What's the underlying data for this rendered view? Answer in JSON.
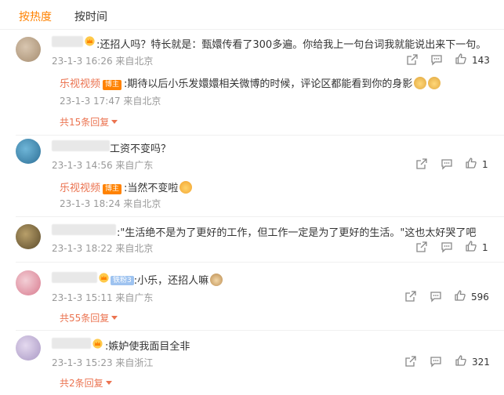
{
  "tabs": {
    "hot": "按热度",
    "time": "按时间"
  },
  "comments": [
    {
      "text": ":还招人吗？特长就是：甄嬛传看了300多遍。你给我上一句台词我就能说出来下一句。",
      "meta": "23-1-3 16:26 来自北京",
      "likes": "143",
      "reply": {
        "name": "乐视视频",
        "badge": "博主",
        "text": ":期待以后小乐发嬛嬛相关微博的时候，评论区都能看到你的身影",
        "meta": "23-1-3 17:47 来自北京"
      },
      "more": "共15条回复"
    },
    {
      "text": "工资不变吗？",
      "meta": "23-1-3 14:56 来自广东",
      "likes": "1",
      "reply": {
        "name": "乐视视频",
        "badge": "博主",
        "text": ":当然不变啦",
        "meta": "23-1-3 18:24 来自北京"
      }
    },
    {
      "text": ":\"生活绝不是为了更好的工作，但工作一定是为了更好的生活。\"这也太好哭了吧",
      "meta": "23-1-3 18:22 来自北京",
      "likes": "1"
    },
    {
      "text": ":小乐，还招人嘛",
      "badge": "铁粉3",
      "meta": "23-1-3 15:11 来自广东",
      "likes": "596",
      "more": "共55条回复"
    },
    {
      "text": ":嫉妒使我面目全非",
      "meta": "23-1-3 15:23 来自浙江",
      "likes": "321",
      "more": "共2条回复"
    }
  ],
  "colors": {
    "accent": "#ff8200",
    "link": "#eb7350",
    "meta": "#999999"
  },
  "icons": [
    "share-icon",
    "comment-icon",
    "like-icon",
    "crown-icon"
  ]
}
